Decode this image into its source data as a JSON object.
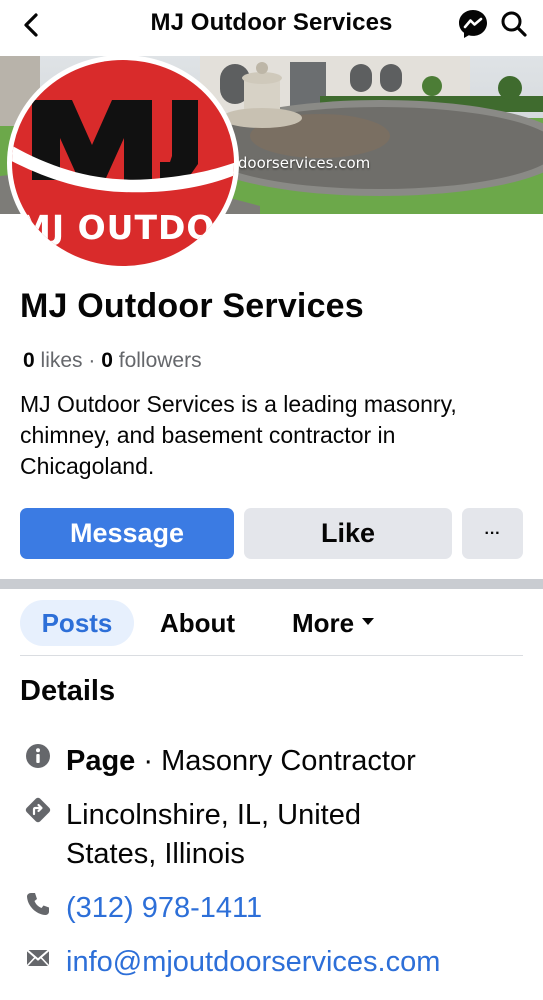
{
  "header": {
    "title": "MJ Outdoor Services",
    "back_icon": "chevron-left-icon",
    "messenger_icon": "messenger-icon",
    "search_icon": "search-icon"
  },
  "cover": {
    "watermark_text": "tdoorservices.com"
  },
  "profile_picture": {
    "logo_text": "MJ OUTDOOR SERVICES"
  },
  "page": {
    "name": "MJ Outdoor Services",
    "likes_count": "0",
    "likes_label": " likes",
    "separator": " · ",
    "followers_count": "0",
    "followers_label": " followers",
    "bio": "MJ Outdoor Services is a leading masonry, chimney, and basement contractor in Chicagoland."
  },
  "actions": {
    "message_label": "Message",
    "like_label": "Like",
    "more_label": "···"
  },
  "tabs": [
    {
      "label": "Posts",
      "active": true
    },
    {
      "label": "About",
      "active": false
    },
    {
      "label": "More",
      "active": false
    }
  ],
  "details": {
    "title": "Details",
    "category_prefix": "Page",
    "category_separator": " · ",
    "category": "Masonry Contractor",
    "location_line1": "Lincolnshire, IL, United",
    "location_line2": "States, Illinois",
    "phone": "(312) 978-1411",
    "email": "info@mjoutdoorservices.com"
  },
  "colors": {
    "accent": "#3b7be3",
    "link": "#2d6fd8",
    "button_gray": "#e4e6eb",
    "logo_red": "#d92b2b"
  }
}
